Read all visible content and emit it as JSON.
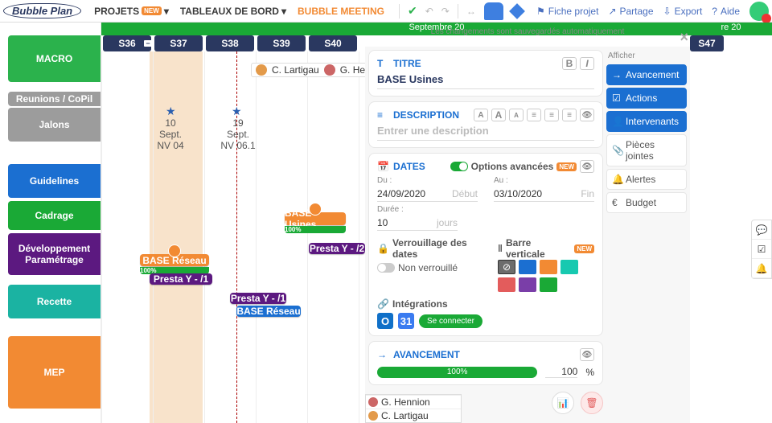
{
  "topbar": {
    "logo": "Bubble Plan",
    "menu": {
      "projets": "PROJETS",
      "badge": "NEW",
      "tableaux": "TABLEAUX DE BORD",
      "meeting": "BUBBLE MEETING"
    },
    "right": {
      "fiche": "Fiche projet",
      "partage": "Partage",
      "export": "Export",
      "aide": "Aide"
    }
  },
  "timeline": {
    "month": "Septembre 20",
    "month2": "re 20",
    "weeks": [
      "S36",
      "S37",
      "S38",
      "S39",
      "S40"
    ],
    "week_extra": "S47",
    "rows": {
      "macro": "MACRO",
      "reunions": "Reunions / CoPil",
      "jalons": "Jalons",
      "guidelines": "Guidelines",
      "cadrage": "Cadrage",
      "dev": "Développement Paramétrage",
      "recette": "Recette",
      "mep": "MEP"
    },
    "milestones": {
      "m1_date": "10 Sept.",
      "m1_name": "NV 04",
      "m2_date": "19 Sept.",
      "m2_name": "NV 06.1"
    },
    "people": {
      "p1": "C. Lartigau",
      "p2": "G. Hennion"
    },
    "bars": {
      "base_usines": "BASE Usines",
      "base_usines_pct": "100%",
      "presta_y2": "Presta Y - /2",
      "base_reseau": "BASE Réseau",
      "base_reseau_pct": "100%",
      "presta_y1": "Presta Y - /1",
      "presta_y1b": "Presta Y - /1",
      "base_reseau2": "BASE Réseau"
    }
  },
  "panel": {
    "save_msg": "Les changements sont sauvegardés automatiquement",
    "titre": {
      "head": "TITRE",
      "value": "BASE Usines"
    },
    "description": {
      "head": "DESCRIPTION",
      "placeholder": "Entrer une description"
    },
    "dates": {
      "head": "DATES",
      "options": "Options avancées",
      "du": "Du :",
      "au": "Au :",
      "from": "24/09/2020",
      "to": "03/10/2020",
      "debut": "Début",
      "fin": "Fin",
      "duree_lbl": "Durée :",
      "duree": "10",
      "jours": "jours",
      "lock_head": "Verrouillage des dates",
      "lock_state": "Non verrouillé",
      "vbar": "Barre verticale"
    },
    "integrations": {
      "head": "Intégrations",
      "connect": "Se connecter"
    },
    "avancement": {
      "head": "AVANCEMENT",
      "pct": "100",
      "unit": "%",
      "bar": "100%"
    },
    "side": {
      "title": "Afficher",
      "avancement": "Avancement",
      "actions": "Actions",
      "intervenants": "Intervenants",
      "pj": "Pièces jointes",
      "alertes": "Alertes",
      "budget": "Budget"
    }
  },
  "colors": {
    "list": [
      "#6c6c6c",
      "#1b6fd1",
      "#f28a33",
      "#17c9b0",
      "#e35c5c",
      "#5c1980",
      "#1aa936"
    ]
  }
}
